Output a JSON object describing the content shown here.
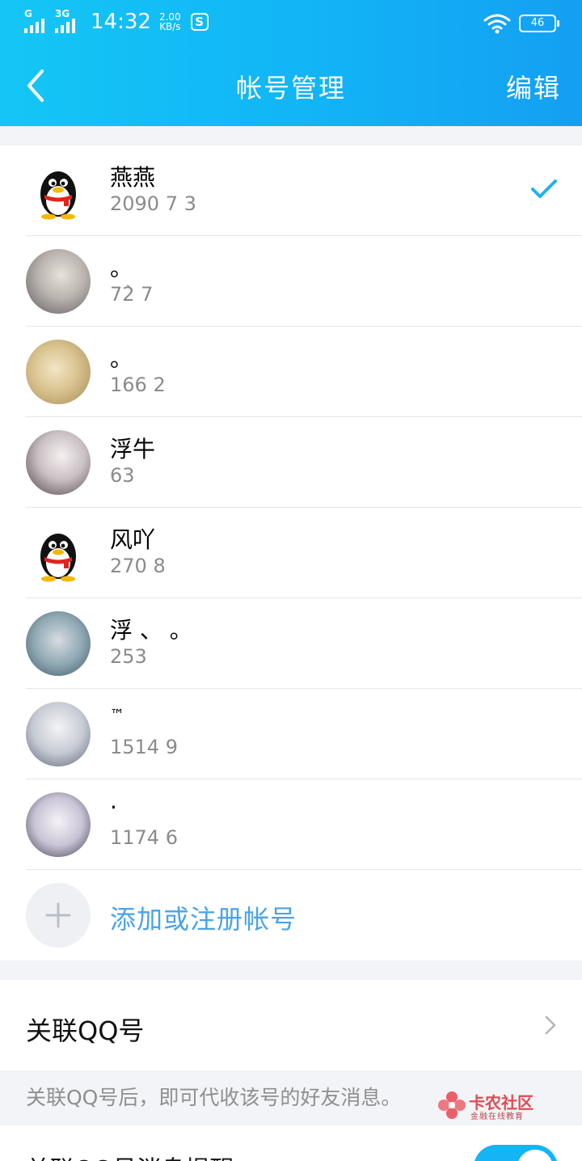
{
  "status_bar": {
    "signal_1_label": "G",
    "signal_2_label": "3G",
    "time": "14:32",
    "speed_value": "2.00",
    "speed_unit": "KB/s",
    "app_badge": "S",
    "battery_level": "46"
  },
  "header": {
    "title": "帐号管理",
    "edit_label": "编辑"
  },
  "accounts": [
    {
      "name": "燕燕",
      "number": "2090    7     3",
      "avatar": "qq-penguin-icon",
      "selected": true
    },
    {
      "name": "。",
      "number": "72̀   7",
      "avatar": "photo",
      "selected": false
    },
    {
      "name": "。",
      "number": "166 2",
      "avatar": "photo",
      "selected": false
    },
    {
      "name": "浮牛",
      "number": "63",
      "avatar": "photo",
      "selected": false
    },
    {
      "name": "风吖",
      "number": "270  8",
      "avatar": "qq-penguin-icon",
      "selected": false
    },
    {
      "name": "  浮   、 。",
      "number": "253",
      "avatar": "photo",
      "selected": false
    },
    {
      "name": "™",
      "number": "1514    9",
      "avatar": "photo",
      "selected": false
    },
    {
      "name": "  ·   ",
      "number": "1174  6",
      "avatar": "photo",
      "selected": false
    }
  ],
  "add_account": {
    "label": "添加或注册帐号"
  },
  "link_account": {
    "label": "关联QQ号",
    "note": "关联QQ号后，即可代收该号的好友消息。"
  },
  "watermark": {
    "title": "卡农社区",
    "subtitle": "金融在线教育"
  },
  "last_row": {
    "label": "关联QQ号消息提醒",
    "toggle_on": true
  },
  "colors": {
    "header_start": "#14c6f5",
    "header_end": "#149ff2",
    "accent": "#4aa3e8",
    "check": "#1fb3ee",
    "toggle": "#13b5f3"
  }
}
